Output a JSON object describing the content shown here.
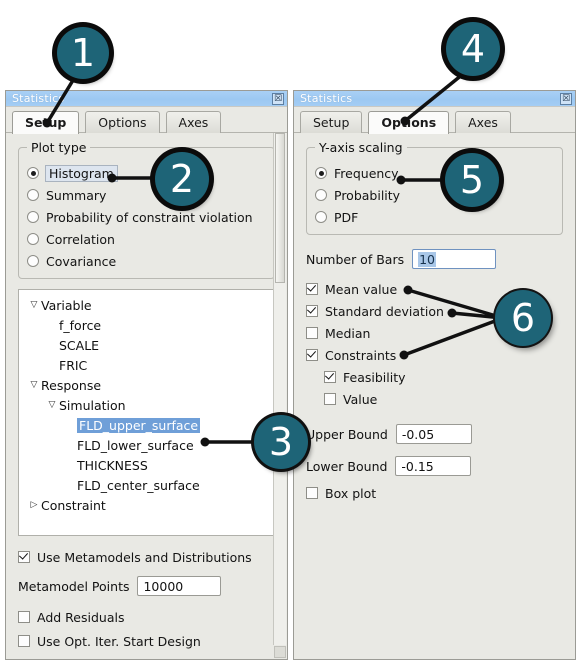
{
  "windows": {
    "setup": {
      "title": "Statistics",
      "close_label": "☒",
      "tabs": [
        {
          "label": "Setup",
          "active": true
        },
        {
          "label": "Options",
          "active": false
        },
        {
          "label": "Axes",
          "active": false
        }
      ],
      "plot_type": {
        "legend": "Plot type",
        "options": [
          {
            "label": "Histogram",
            "selected": true,
            "focused": true
          },
          {
            "label": "Summary",
            "selected": false,
            "focused": false
          },
          {
            "label": "Probability of constraint violation",
            "selected": false,
            "focused": false
          },
          {
            "label": "Correlation",
            "selected": false,
            "focused": false
          },
          {
            "label": "Covariance",
            "selected": false,
            "focused": false
          }
        ]
      },
      "tree": [
        {
          "label": "Variable",
          "level": 1,
          "twisty": "▽",
          "selected": false
        },
        {
          "label": "f_force",
          "level": 2,
          "twisty": "",
          "selected": false
        },
        {
          "label": "SCALE",
          "level": 2,
          "twisty": "",
          "selected": false
        },
        {
          "label": "FRIC",
          "level": 2,
          "twisty": "",
          "selected": false
        },
        {
          "label": "Response",
          "level": 1,
          "twisty": "▽",
          "selected": false
        },
        {
          "label": "Simulation",
          "level": 2,
          "twisty": "▽",
          "selected": false
        },
        {
          "label": "FLD_upper_surface",
          "level": 3,
          "twisty": "",
          "selected": true
        },
        {
          "label": "FLD_lower_surface",
          "level": 3,
          "twisty": "",
          "selected": false
        },
        {
          "label": "THICKNESS",
          "level": 3,
          "twisty": "",
          "selected": false
        },
        {
          "label": "FLD_center_surface",
          "level": 3,
          "twisty": "",
          "selected": false
        },
        {
          "label": "Constraint",
          "level": 1,
          "twisty": "▷",
          "selected": false
        }
      ],
      "metamodels_checkbox": {
        "label": "Use Metamodels and Distributions",
        "checked": true
      },
      "metamodel_points": {
        "label": "Metamodel Points",
        "value": "10000"
      },
      "add_residuals": {
        "label": "Add Residuals",
        "checked": false
      },
      "use_opt_iter": {
        "label": "Use Opt. Iter. Start Design",
        "checked": false
      }
    },
    "options": {
      "title": "Statistics",
      "close_label": "☒",
      "tabs": [
        {
          "label": "Setup",
          "active": false
        },
        {
          "label": "Options",
          "active": true
        },
        {
          "label": "Axes",
          "active": false
        }
      ],
      "yaxis_scaling": {
        "legend": "Y-axis scaling",
        "options": [
          {
            "label": "Frequency",
            "selected": true
          },
          {
            "label": "Probability",
            "selected": false
          },
          {
            "label": "PDF",
            "selected": false
          }
        ]
      },
      "number_of_bars": {
        "label": "Number of Bars",
        "value": "10"
      },
      "checks": [
        {
          "label": "Mean value",
          "checked": true,
          "indent": 0
        },
        {
          "label": "Standard deviation",
          "checked": true,
          "indent": 0
        },
        {
          "label": "Median",
          "checked": false,
          "indent": 0
        },
        {
          "label": "Constraints",
          "checked": true,
          "indent": 0
        },
        {
          "label": "Feasibility",
          "checked": true,
          "indent": 1
        },
        {
          "label": "Value",
          "checked": false,
          "indent": 1
        }
      ],
      "upper_bound": {
        "label": "Upper Bound",
        "value": "-0.05"
      },
      "lower_bound": {
        "label": "Lower Bound",
        "value": "-0.15"
      },
      "box_plot": {
        "label": "Box plot",
        "checked": false
      }
    }
  },
  "callouts": [
    {
      "number": "1",
      "target": "setup-tab"
    },
    {
      "number": "2",
      "target": "histogram-radio"
    },
    {
      "number": "3",
      "target": "fld-upper-surface-tree-item"
    },
    {
      "number": "4",
      "target": "options-tab"
    },
    {
      "number": "5",
      "target": "frequency-radio"
    },
    {
      "number": "6",
      "target": "statistics-checkboxes"
    }
  ],
  "colors": {
    "badge_fill": "#1e6477",
    "badge_ring": "#0b0b0b",
    "titlebar": "#9cc8f2",
    "selection": "#6f9fd8",
    "panel_bg": "#e9e9e4"
  }
}
